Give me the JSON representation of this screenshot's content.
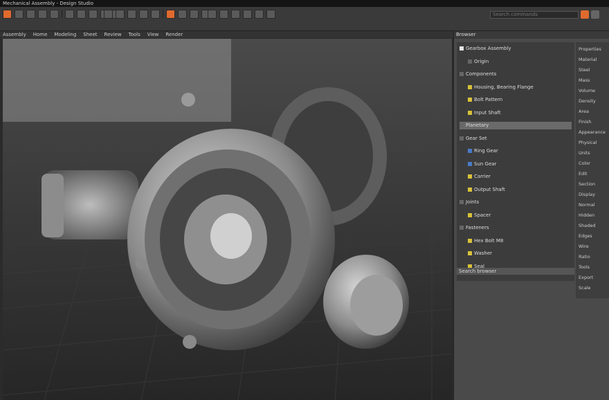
{
  "title_bar": {
    "text": "Mechanical Assembly - Design Studio"
  },
  "toolbar": {
    "search_placeholder": "Search commands"
  },
  "menubar": [
    "Assembly",
    "Home",
    "Modeling",
    "Sheet",
    "Review",
    "Tools",
    "View",
    "Render"
  ],
  "browser": {
    "title": "Browser",
    "items": [
      {
        "label": "Gearbox Assembly",
        "level": 1,
        "icon": "assembly-icon"
      },
      {
        "label": "Origin",
        "level": 2,
        "icon": "folder-icon"
      },
      {
        "label": "Components",
        "level": 1,
        "icon": "folder-icon"
      },
      {
        "label": "Housing, Bearing Flange",
        "level": 2,
        "icon": "part-icon"
      },
      {
        "label": "Bolt Pattern",
        "level": 2,
        "icon": "part-icon"
      },
      {
        "label": "Input Shaft",
        "level": 2,
        "icon": "part-icon"
      },
      {
        "label": "Planetary",
        "level": 1,
        "icon": "folder-icon",
        "selected": true
      },
      {
        "label": "Gear Set",
        "level": 1,
        "icon": "folder-icon"
      },
      {
        "label": "Ring Gear",
        "level": 2,
        "icon": "gear-icon"
      },
      {
        "label": "Sun Gear",
        "level": 2,
        "icon": "gear-icon"
      },
      {
        "label": "Carrier",
        "level": 2,
        "icon": "part-icon"
      },
      {
        "label": "Output Shaft",
        "level": 2,
        "icon": "part-icon"
      },
      {
        "label": "Joints",
        "level": 1,
        "icon": "folder-icon"
      },
      {
        "label": "Spacer",
        "level": 2,
        "icon": "part-icon"
      },
      {
        "label": "Fasteners",
        "level": 1,
        "icon": "folder-icon"
      },
      {
        "label": "Hex Bolt M8",
        "level": 2,
        "icon": "bolt-icon"
      },
      {
        "label": "Washer",
        "level": 2,
        "icon": "bolt-icon"
      },
      {
        "label": "Seal",
        "level": 2,
        "icon": "part-icon"
      }
    ],
    "footer": "Search browser"
  },
  "properties": {
    "items": [
      "Properties",
      "Material",
      "Steel",
      "Mass",
      "Volume",
      "Density",
      "Area",
      "Finish",
      "Appearance",
      "Physical",
      "Units",
      "Color",
      "Edit",
      "Section",
      "Display",
      "Normal",
      "Hidden",
      "Shaded",
      "Edges",
      "Wire",
      "Ratio",
      "Tools",
      "Export",
      "Scale"
    ]
  },
  "colors": {
    "accent": "#e06a2e",
    "panel_bg": "#4a4a4a",
    "viewport_bg": "#3d3d3d"
  }
}
